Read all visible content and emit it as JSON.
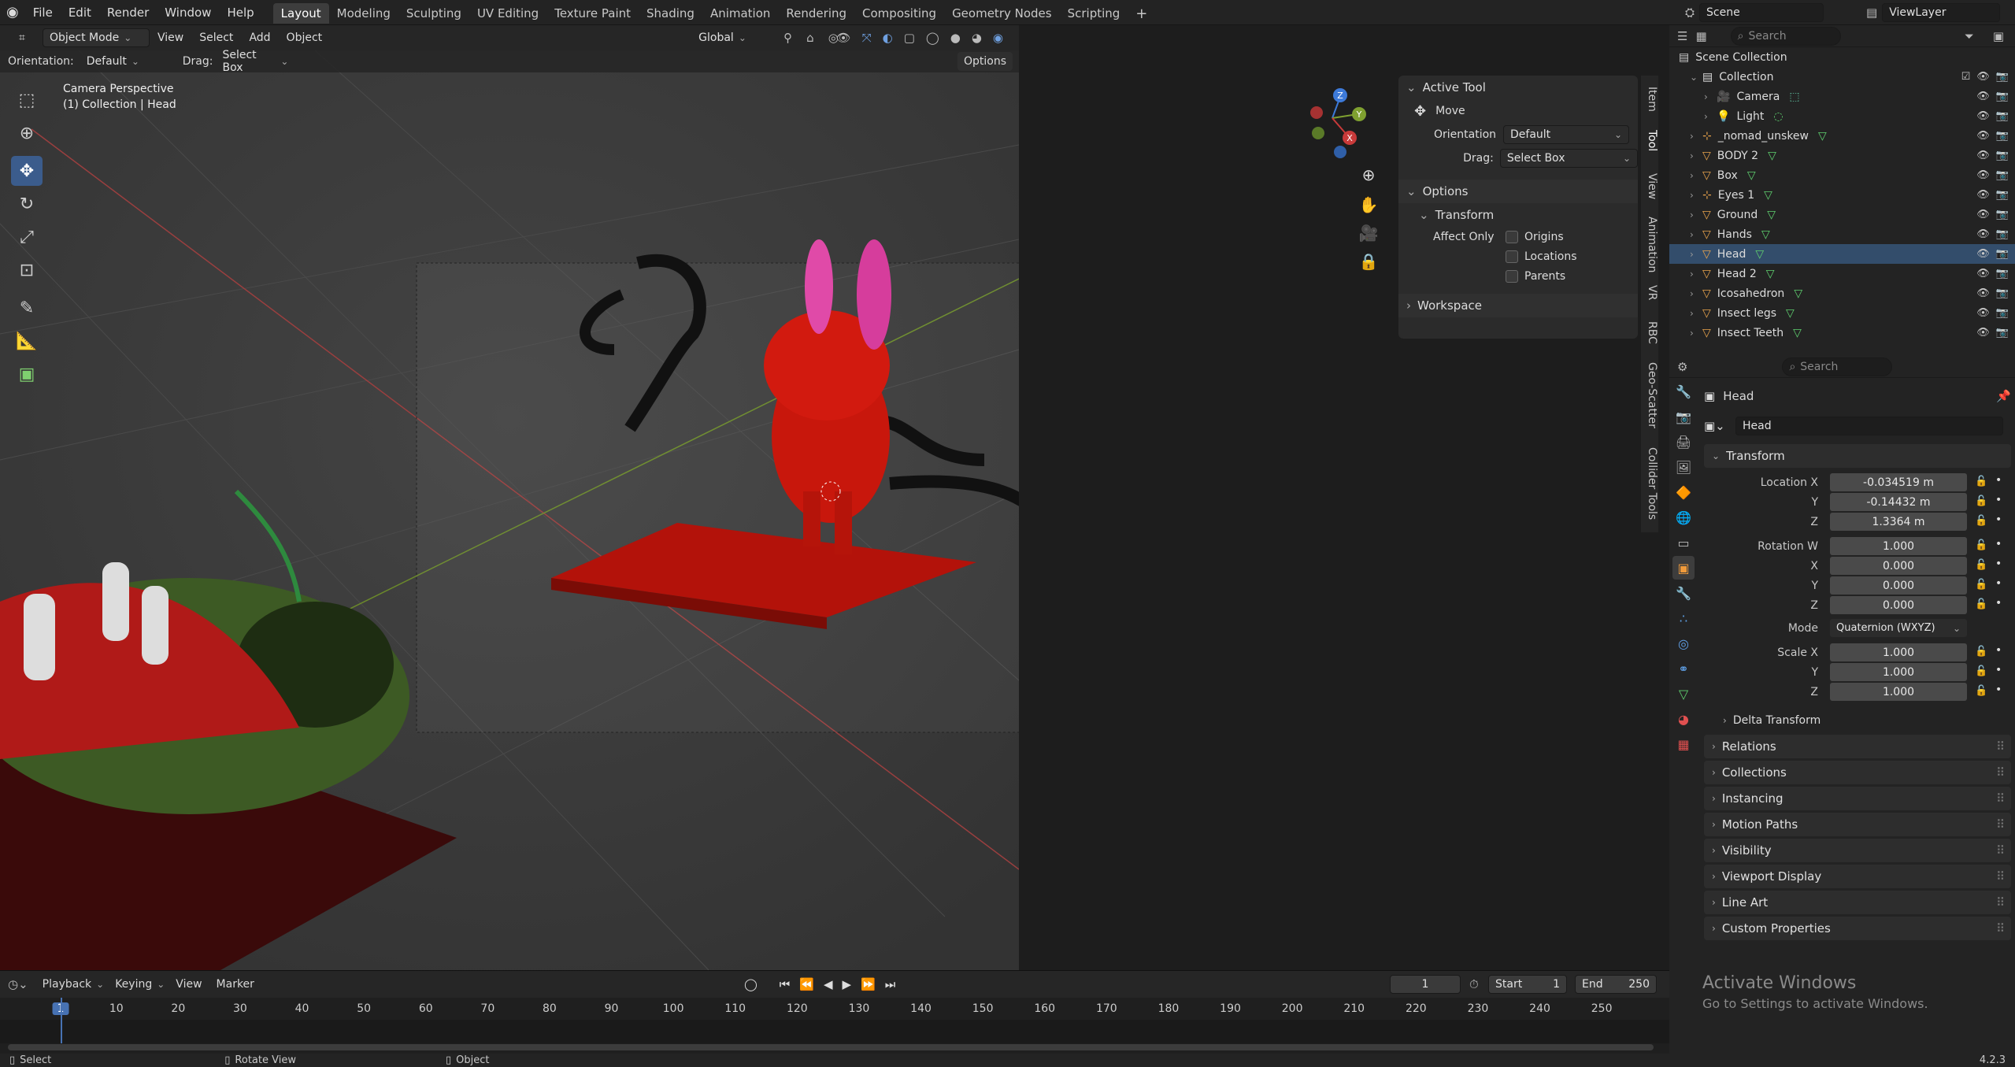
{
  "menu": {
    "file": "File",
    "edit": "Edit",
    "render": "Render",
    "window": "Window",
    "help": "Help"
  },
  "workspaces": [
    "Layout",
    "Modeling",
    "Sculpting",
    "UV Editing",
    "Texture Paint",
    "Shading",
    "Animation",
    "Rendering",
    "Compositing",
    "Geometry Nodes",
    "Scripting"
  ],
  "scene": {
    "name": "Scene",
    "view_layer": "ViewLayer"
  },
  "header": {
    "mode": "Object Mode",
    "view": "View",
    "select": "Select",
    "add": "Add",
    "object": "Object",
    "transform_orientation": "Global",
    "options": "Options"
  },
  "tool_settings": {
    "orientation_label": "Orientation:",
    "orientation_value": "Default",
    "drag_label": "Drag:",
    "drag_value": "Select Box"
  },
  "viewport": {
    "camera_label": "Camera Perspective",
    "collection_label": "(1) Collection | Head",
    "gizmo_axes": [
      "X",
      "Y",
      "Z"
    ]
  },
  "npanel": {
    "active_tool": "Active Tool",
    "tool_name": "Move",
    "orientation_label": "Orientation",
    "orientation_value": "Default",
    "drag_label": "Drag:",
    "drag_value": "Select Box",
    "options": "Options",
    "transform": "Transform",
    "affect_only": "Affect Only",
    "origins": "Origins",
    "locations": "Locations",
    "parents": "Parents",
    "workspace": "Workspace",
    "side_tabs": [
      "Item",
      "Tool",
      "View",
      "Animation",
      "VR",
      "RBC",
      "Geo-Scatter",
      "Collider Tools"
    ]
  },
  "outliner": {
    "search_placeholder": "Search",
    "root": "Scene Collection",
    "items": [
      {
        "name": "Collection",
        "indent": 1,
        "type": "collection"
      },
      {
        "name": "Camera",
        "indent": 2,
        "type": "camera"
      },
      {
        "name": "Light",
        "indent": 2,
        "type": "light"
      },
      {
        "name": "_nomad_unskew",
        "indent": 1,
        "type": "empty"
      },
      {
        "name": "BODY 2",
        "indent": 1,
        "type": "mesh"
      },
      {
        "name": "Box",
        "indent": 1,
        "type": "mesh"
      },
      {
        "name": "Eyes 1",
        "indent": 1,
        "type": "empty"
      },
      {
        "name": "Ground",
        "indent": 1,
        "type": "mesh"
      },
      {
        "name": "Hands",
        "indent": 1,
        "type": "mesh"
      },
      {
        "name": "Head",
        "indent": 1,
        "type": "mesh",
        "selected": true
      },
      {
        "name": "Head 2",
        "indent": 1,
        "type": "mesh"
      },
      {
        "name": "Icosahedron",
        "indent": 1,
        "type": "mesh"
      },
      {
        "name": "Insect legs",
        "indent": 1,
        "type": "mesh"
      },
      {
        "name": "Insect Teeth",
        "indent": 1,
        "type": "mesh"
      }
    ]
  },
  "properties": {
    "search_placeholder": "Search",
    "object_name": "Head",
    "data_name": "Head",
    "transform": "Transform",
    "location_label": "Location X",
    "loc_x": "-0.034519 m",
    "loc_y": "-0.14432 m",
    "loc_z": "1.3364 m",
    "rotation_label": "Rotation W",
    "rot_w": "1.000",
    "rot_x": "0.000",
    "rot_y": "0.000",
    "rot_z": "0.000",
    "mode_label": "Mode",
    "mode_value": "Quaternion (WXYZ)",
    "scale_label": "Scale X",
    "scale_x": "1.000",
    "scale_y": "1.000",
    "scale_z": "1.000",
    "y_label": "Y",
    "z_label": "Z",
    "x_label": "X",
    "delta_transform": "Delta Transform",
    "sections": [
      "Relations",
      "Collections",
      "Instancing",
      "Motion Paths",
      "Visibility",
      "Viewport Display",
      "Line Art",
      "Custom Properties"
    ]
  },
  "activate_windows": {
    "title": "Activate Windows",
    "subtitle": "Go to Settings to activate Windows."
  },
  "timeline": {
    "playback": "Playback",
    "keying": "Keying",
    "view": "View",
    "marker": "Marker",
    "current_frame": "1",
    "start_label": "Start",
    "start": "1",
    "end_label": "End",
    "end": "250",
    "ticks": [
      "1",
      "10",
      "20",
      "30",
      "40",
      "50",
      "60",
      "70",
      "80",
      "90",
      "100",
      "110",
      "120",
      "130",
      "140",
      "150",
      "160",
      "170",
      "180",
      "190",
      "200",
      "210",
      "220",
      "230",
      "240",
      "250"
    ]
  },
  "status": {
    "select": "Select",
    "rotate_view": "Rotate View",
    "object": "Object",
    "version": "4.2.3"
  },
  "colors": {
    "accent": "#3b5c8c",
    "selected_row": "#334d6b",
    "timeline_cursor": "#4772b3"
  }
}
